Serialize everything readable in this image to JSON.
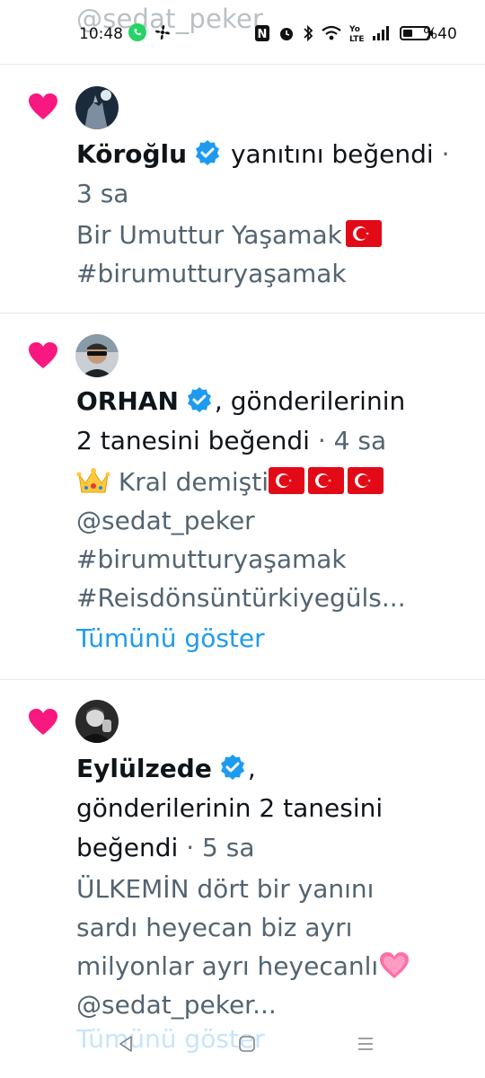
{
  "status_bar": {
    "time": "10:48",
    "battery_text": "%40",
    "icons": [
      "whatsapp-icon",
      "fan-icon",
      "nfc-icon",
      "alarm-icon",
      "bluetooth-icon",
      "wifi-icon",
      "volte-icon",
      "signal-icon",
      "battery-icon"
    ],
    "battery_level": 0.4
  },
  "faded_header_text": "@sedat_peker",
  "items": [
    {
      "name": "Köroğlu",
      "action": "yanıtını beğendi",
      "separator": "·",
      "time": "3 sa",
      "line1": "Bir Umuttur Yaşamak",
      "line2": "#birumutturyaşamak"
    },
    {
      "name": "ORHAN",
      "comma": ",",
      "action_line1": "gönderilerinin",
      "action_line2": "2 tanesini beğendi",
      "separator": "·",
      "time": "4 sa",
      "line1": "Kral demişti",
      "line2": "@sedat_peker",
      "line3": "#birumutturyaşamak",
      "line4": "#Reisdönsüntürkiyegüls...",
      "show_more": "Tümünü göster"
    },
    {
      "name": "Eylülzede",
      "comma": ",",
      "action_line1": "gönderilerinin 2 tanesini",
      "action_line2": "beğendi",
      "separator": "·",
      "time": "5 sa",
      "line1": "ÜLKEMİN dört bir yanını",
      "line2": "sardı heyecan biz ayrı",
      "line3": "milyonlar ayrı heyecanlı",
      "line4": "@sedat_peker...",
      "show_more": "Tümünü göster"
    }
  ],
  "colors": {
    "heart": "#f91880",
    "verified": "#1d9bf0",
    "link": "#1d9bf0",
    "secondary_text": "#536471"
  }
}
